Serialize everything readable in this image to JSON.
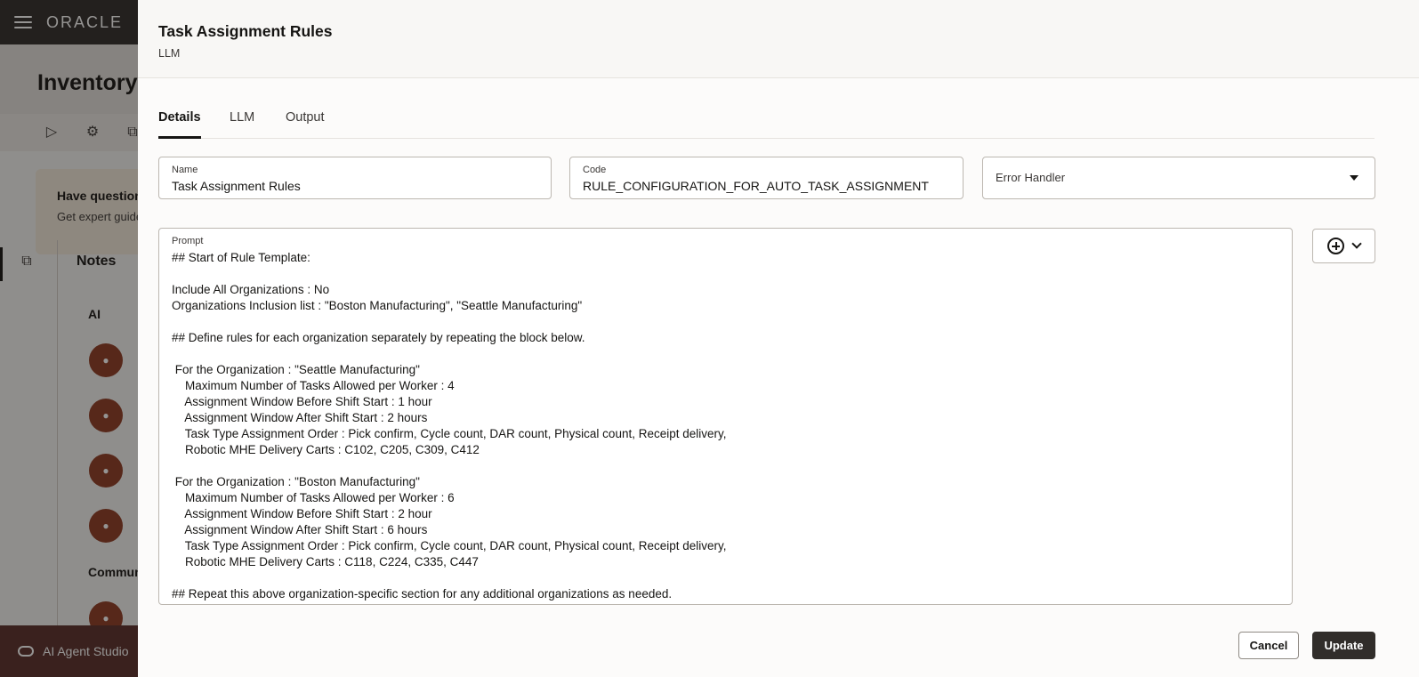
{
  "background": {
    "brand": "ORACLE",
    "page_title": "Inventory",
    "help_title": "Have question",
    "help_sub": "Get expert guide",
    "notes_title": "Notes",
    "notes_section": "AI",
    "community_title": "Commun",
    "footer_label": "AI Agent Studio"
  },
  "drawer": {
    "title": "Task Assignment Rules",
    "subtitle": "LLM",
    "tabs": [
      "Details",
      "LLM",
      "Output"
    ],
    "active_tab": "Details",
    "fields": {
      "name": {
        "label": "Name",
        "value": "Task Assignment Rules"
      },
      "code": {
        "label": "Code",
        "value": "RULE_CONFIGURATION_FOR_AUTO_TASK_ASSIGNMENT"
      },
      "error_handler": {
        "placeholder": "Error Handler"
      }
    },
    "prompt": {
      "label": "Prompt",
      "text": "## Start of Rule Template:\n\nInclude All Organizations : No\nOrganizations Inclusion list : \"Boston Manufacturing\", \"Seattle Manufacturing\"\n\n## Define rules for each organization separately by repeating the block below.\n\n For the Organization : \"Seattle Manufacturing\"\n    Maximum Number of Tasks Allowed per Worker : 4\n    Assignment Window Before Shift Start : 1 hour\n    Assignment Window After Shift Start : 2 hours\n    Task Type Assignment Order : Pick confirm, Cycle count, DAR count, Physical count, Receipt delivery,\n    Robotic MHE Delivery Carts : C102, C205, C309, C412\n\n For the Organization : \"Boston Manufacturing\"\n    Maximum Number of Tasks Allowed per Worker : 6\n    Assignment Window Before Shift Start : 2 hour\n    Assignment Window After Shift Start : 6 hours\n    Task Type Assignment Order : Pick confirm, Cycle count, DAR count, Physical count, Receipt delivery,\n    Robotic MHE Delivery Carts : C118, C224, C335, C447\n\n## Repeat this above organization-specific section for any additional organizations as needed."
    },
    "buttons": {
      "cancel": "Cancel",
      "update": "Update"
    }
  },
  "colors": {
    "topbar": "#312d2a",
    "avatar": "#8f3b23",
    "primary_button": "#312d2a",
    "footer": "#5a2e2a"
  },
  "icons": [
    "hamburger-icon",
    "play-icon",
    "gear-icon",
    "copy-icon",
    "hierarchy-icon",
    "add-circle-icon",
    "chevron-down-icon",
    "caret-down-icon",
    "user-icon",
    "agent-icon"
  ]
}
